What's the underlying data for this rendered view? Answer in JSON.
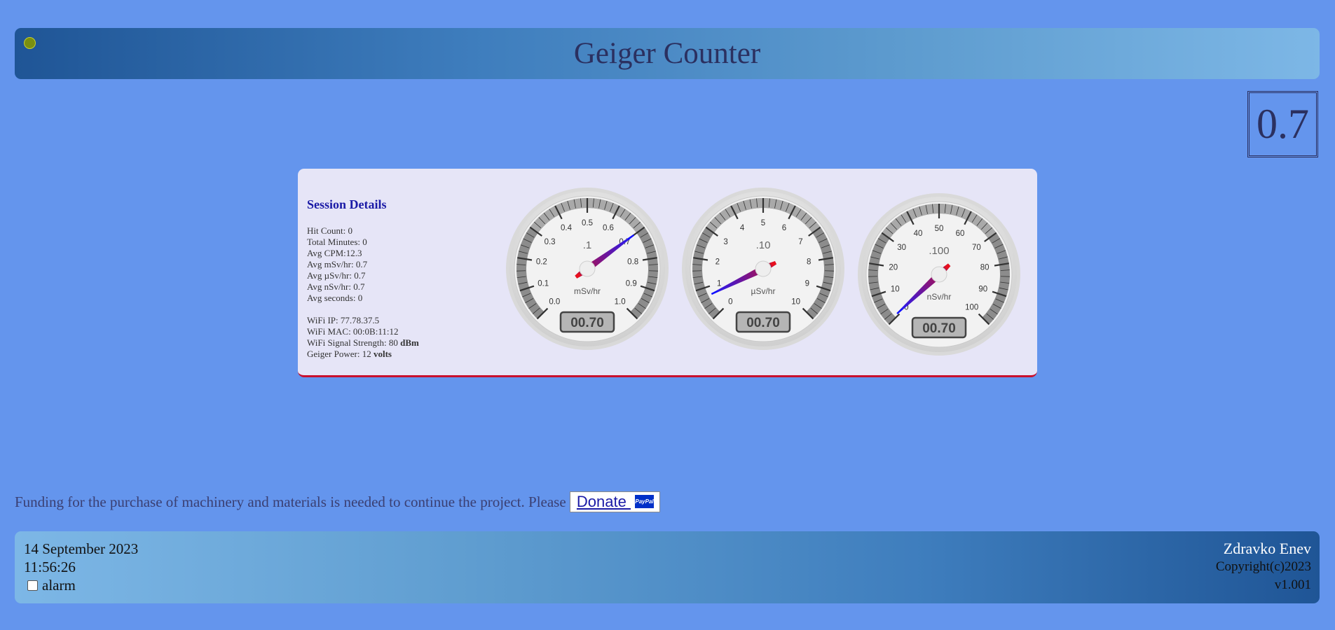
{
  "header": {
    "title": "Geiger Counter",
    "status_color": "#7a8f10"
  },
  "big_reading": "0.7",
  "session": {
    "title": "Session Details",
    "hit_count": "Hit Count: 0",
    "total_minutes": "Total Minutes: 0",
    "avg_cpm": "Avg CPM:12.3",
    "avg_msv": "Avg mSv/hr: 0.7",
    "avg_usv": "Avg µSv/hr: 0.7",
    "avg_nsv": "Avg nSv/hr: 0.7",
    "avg_seconds": "Avg seconds: 0",
    "wifi_ip": "WiFi IP: 77.78.37.5",
    "wifi_mac": "WiFi MAC: 00:0B:11:12",
    "wifi_signal_prefix": "WiFi Signal Strength: 80 ",
    "wifi_signal_unit": "dBm",
    "geiger_power_prefix": "Geiger Power: 12 ",
    "geiger_power_unit": "volts"
  },
  "gauges": [
    {
      "unit": "mSv/hr",
      "multiplier": ".1",
      "labels": [
        "0.0",
        "0.1",
        "0.2",
        "0.3",
        "0.4",
        "0.5",
        "0.6",
        "0.7",
        "0.8",
        "0.9",
        "1.0"
      ],
      "value": 0.7,
      "max": 1.0,
      "readout": "00.70"
    },
    {
      "unit": "µSv/hr",
      "multiplier": ".10",
      "labels": [
        "0",
        "1",
        "2",
        "3",
        "4",
        "5",
        "6",
        "7",
        "8",
        "9",
        "10"
      ],
      "value": 0.7,
      "max": 10,
      "readout": "00.70"
    },
    {
      "unit": "nSv/hr",
      "multiplier": ".100",
      "labels": [
        "0",
        "10",
        "20",
        "30",
        "40",
        "50",
        "60",
        "70",
        "80",
        "90",
        "100"
      ],
      "value": 0.7,
      "max": 100,
      "readout": "00.70"
    }
  ],
  "funding": {
    "message": "Funding for the purchase of machinery and materials is needed to continue the project. Please ",
    "donate_label": "Donate ",
    "paypal_text": "PayPal"
  },
  "footer": {
    "date": "14 September 2023",
    "time": "11:56:26",
    "alarm_label": "alarm",
    "alarm_checked": false,
    "author": "Zdravko Enev",
    "copyright": "Copyright(c)2023",
    "version": "v1.001"
  }
}
